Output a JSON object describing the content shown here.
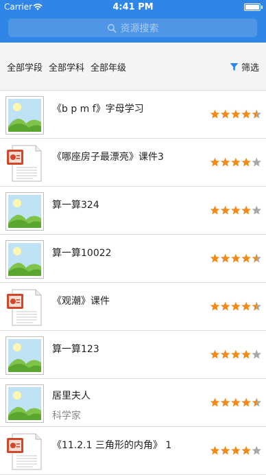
{
  "status": {
    "carrier": "Carrier",
    "time": "4:41 PM"
  },
  "search": {
    "placeholder": "资源搜索"
  },
  "filters": {
    "stage": "全部学段",
    "subject": "全部学科",
    "grade": "全部年级",
    "screen": "筛选"
  },
  "colors": {
    "accent": "#2f86e6",
    "star_on": "#f08a1c",
    "star_off": "#a8a8a8"
  },
  "items": [
    {
      "icon": "image-icon",
      "title": "《b p m f》字母学习",
      "subtitle": "",
      "rating": 4.5
    },
    {
      "icon": "ppt-file-icon",
      "title": "《哪座房子最漂亮》课件3",
      "subtitle": "",
      "rating": 4
    },
    {
      "icon": "image-icon",
      "title": "算一算324",
      "subtitle": "",
      "rating": 4
    },
    {
      "icon": "image-icon",
      "title": "算一算10022",
      "subtitle": "",
      "rating": 4.5
    },
    {
      "icon": "ppt-file-icon",
      "title": "《观潮》课件",
      "subtitle": "",
      "rating": 4.5
    },
    {
      "icon": "image-icon",
      "title": "算一算123",
      "subtitle": "",
      "rating": 4
    },
    {
      "icon": "image-icon",
      "title": "居里夫人",
      "subtitle": "科学家",
      "rating": 4.5
    },
    {
      "icon": "ppt-file-icon",
      "title": "《11.2.1 三角形的内角》 1",
      "subtitle": "",
      "rating": 4
    }
  ]
}
